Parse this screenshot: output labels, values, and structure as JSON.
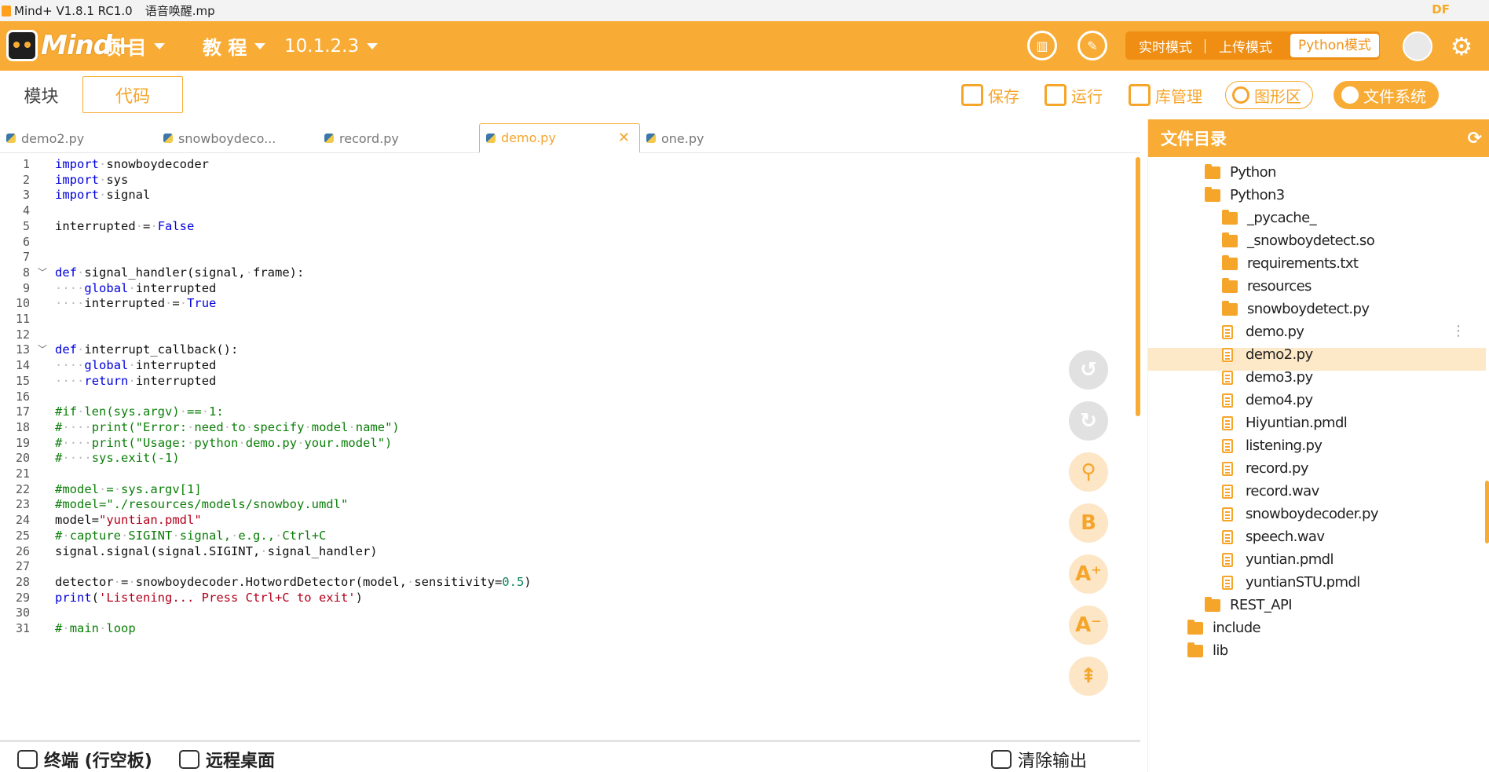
{
  "window": {
    "title": "Mind+ V1.8.1 RC1.0",
    "file": "语音唤醒.mp",
    "watermark": "DF"
  },
  "header": {
    "logo_text": "Mind+",
    "menu_project": "项 目",
    "menu_tutorial": "教 程",
    "menu_ip": "10.1.2.3",
    "modes": [
      "实时模式",
      "上传模式",
      "Python模式"
    ]
  },
  "toolbar": {
    "tab_modules": "模块",
    "tab_code": "代码",
    "save": "保存",
    "run": "运行",
    "library": "库管理",
    "graph": "图形区",
    "filesystem": "文件系统"
  },
  "file_tabs": [
    "demo2.py",
    "snowboydeco...",
    "record.py",
    "demo.py",
    "one.py"
  ],
  "code_lines": [
    "import snowboydecoder",
    "import sys",
    "import signal",
    "",
    "interrupted = False",
    "",
    "",
    "def signal_handler(signal, frame):",
    "    global interrupted",
    "    interrupted = True",
    "",
    "",
    "def interrupt_callback():",
    "    global interrupted",
    "    return interrupted",
    "",
    "#if len(sys.argv) == 1:",
    "#    print(\"Error: need to specify model name\")",
    "#    print(\"Usage: python demo.py your.model\")",
    "#    sys.exit(-1)",
    "",
    "#model = sys.argv[1]",
    "#model=\"./resources/models/snowboy.umdl\"",
    "model=\"yuntian.pmdl\"",
    "# capture SIGINT signal, e.g., Ctrl+C",
    "signal.signal(signal.SIGINT, signal_handler)",
    "",
    "detector = snowboydecoder.HotwordDetector(model, sensitivity=0.5)",
    "print('Listening... Press Ctrl+C to exit')",
    "",
    "# main loop"
  ],
  "bottom": {
    "terminal": "终端 (行空板)",
    "remote": "远程桌面",
    "clear": "清除输出"
  },
  "file_panel": {
    "title": "文件目录",
    "items": [
      {
        "name": "Python",
        "type": "folder",
        "level": 2
      },
      {
        "name": "Python3",
        "type": "folder",
        "level": 2
      },
      {
        "name": "_pycache_",
        "type": "folder",
        "level": 3
      },
      {
        "name": "_snowboydetect.so",
        "type": "folder",
        "level": 3
      },
      {
        "name": "requirements.txt",
        "type": "folder",
        "level": 3
      },
      {
        "name": "resources",
        "type": "folder",
        "level": 3
      },
      {
        "name": "snowboydetect.py",
        "type": "folder",
        "level": 3
      },
      {
        "name": "demo.py",
        "type": "file",
        "level": 3,
        "selected": true
      },
      {
        "name": "demo2.py",
        "type": "file",
        "level": 3
      },
      {
        "name": "demo3.py",
        "type": "file",
        "level": 3
      },
      {
        "name": "demo4.py",
        "type": "file",
        "level": 3
      },
      {
        "name": "Hiyuntian.pmdl",
        "type": "file",
        "level": 3
      },
      {
        "name": "listening.py",
        "type": "file",
        "level": 3
      },
      {
        "name": "record.py",
        "type": "file",
        "level": 3
      },
      {
        "name": "record.wav",
        "type": "file",
        "level": 3
      },
      {
        "name": "snowboydecoder.py",
        "type": "file",
        "level": 3
      },
      {
        "name": "speech.wav",
        "type": "file",
        "level": 3
      },
      {
        "name": "yuntian.pmdl",
        "type": "file",
        "level": 3
      },
      {
        "name": "yuntianSTU.pmdl",
        "type": "file",
        "level": 3
      },
      {
        "name": "REST_API",
        "type": "folder",
        "level": 2
      },
      {
        "name": "include",
        "type": "folder",
        "level": 1
      },
      {
        "name": "lib",
        "type": "folder",
        "level": 1
      }
    ]
  },
  "colors": {
    "accent": "#f9ac35",
    "keyword": "#0000dd",
    "string": "#b3001b",
    "comment": "#0a7e07",
    "number": "#098658"
  }
}
